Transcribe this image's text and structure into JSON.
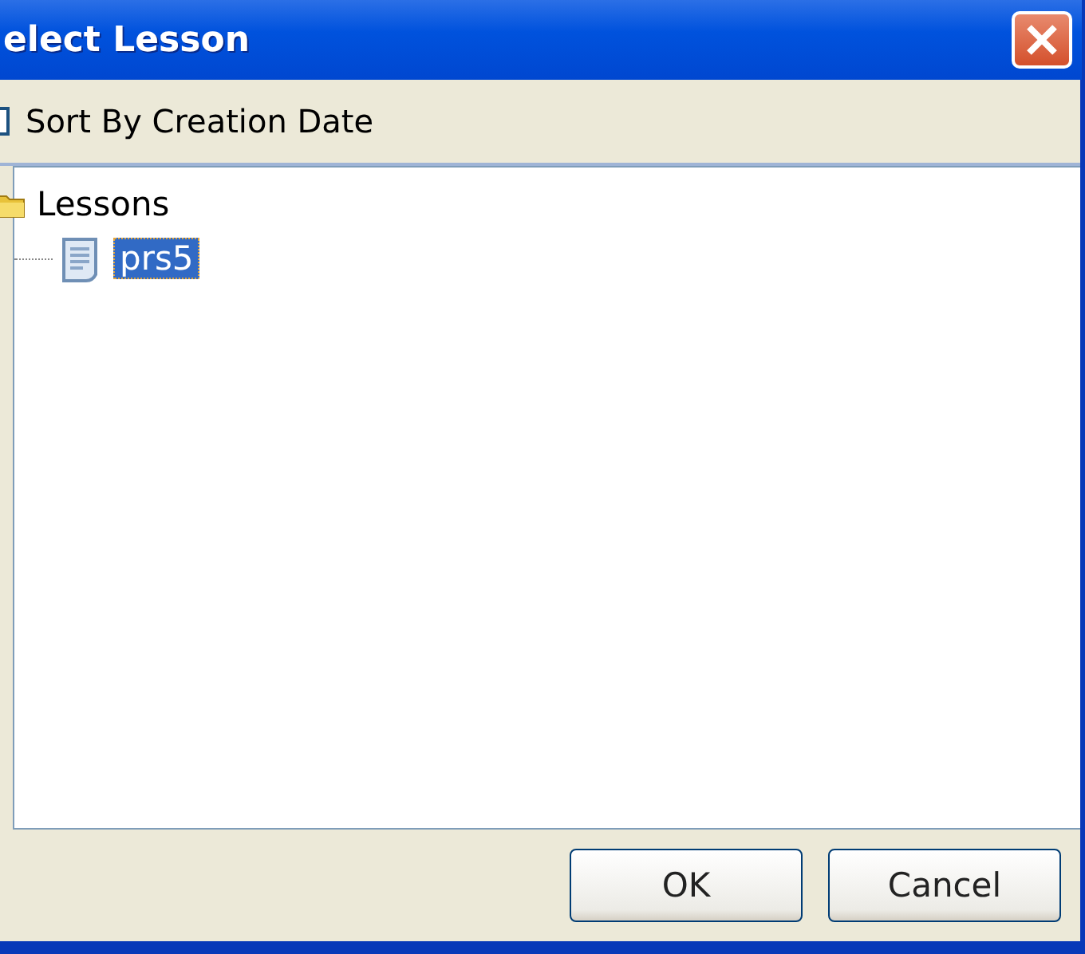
{
  "window": {
    "title": "elect Lesson"
  },
  "options": {
    "label": "Sort By Creation Date",
    "checked": false
  },
  "tree": {
    "label": "Lessons",
    "children": [
      {
        "label": "prs5",
        "selected": true
      }
    ]
  },
  "buttons": [
    "OK",
    "Cancel"
  ]
}
